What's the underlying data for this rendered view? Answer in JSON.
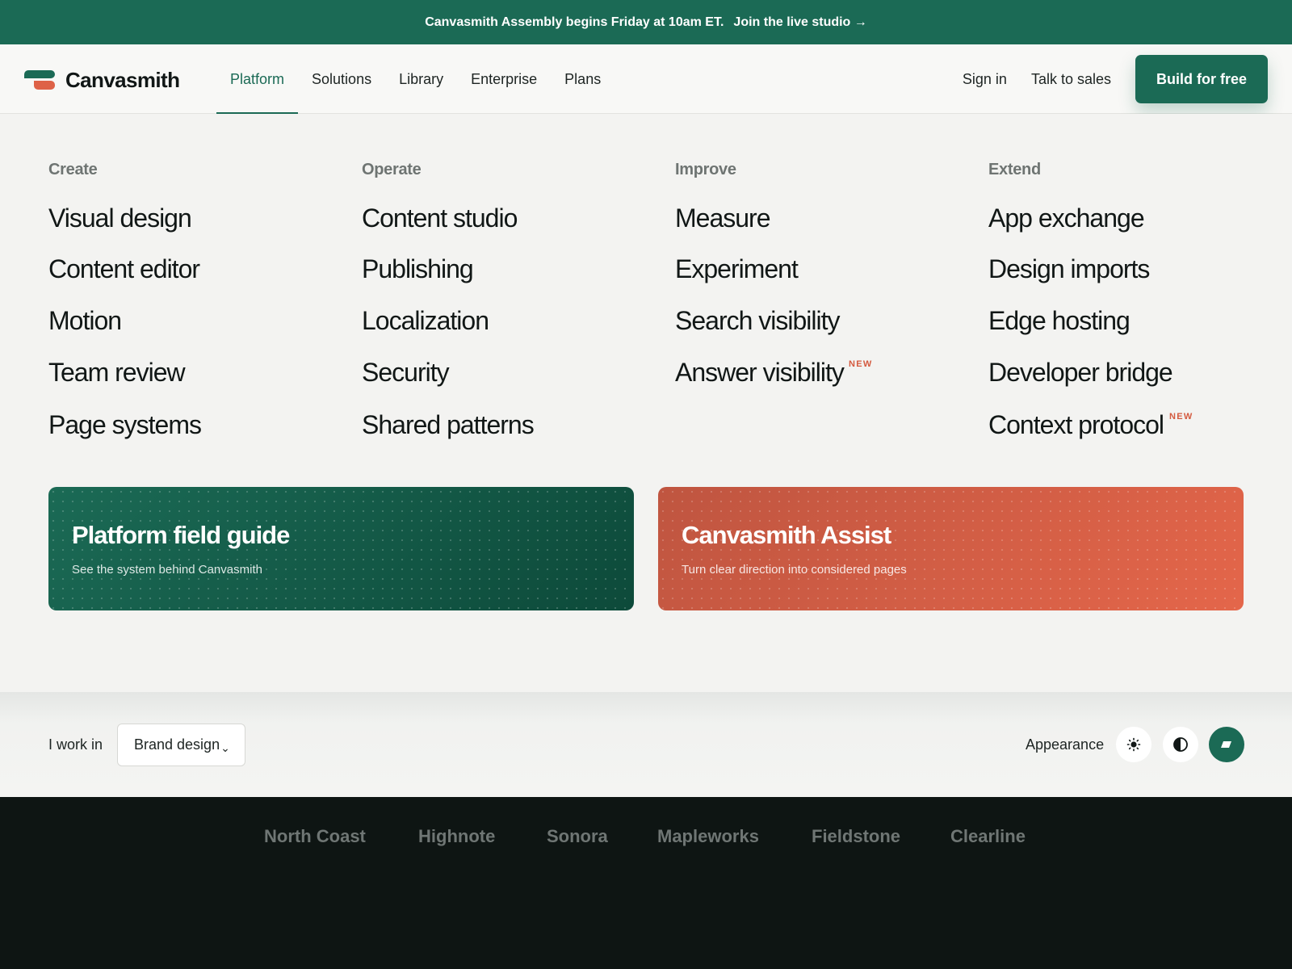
{
  "banner": {
    "text": "Canvasmith Assembly begins Friday at 10am ET.",
    "link": "Join the live studio →"
  },
  "header": {
    "logo_text": "Canvasmith",
    "nav": [
      "Platform",
      "Solutions",
      "Library",
      "Enterprise",
      "Plans"
    ],
    "active_nav": "Platform",
    "sign_in": "Sign in",
    "talk_to_sales": "Talk to sales",
    "cta": "Build for free"
  },
  "menu": {
    "columns": [
      {
        "heading": "Create",
        "items": [
          "Visual design",
          "Content editor",
          "Motion",
          "Team review",
          "Page systems"
        ]
      },
      {
        "heading": "Operate",
        "items": [
          "Content studio",
          "Publishing",
          "Localization",
          "Security",
          "Shared patterns"
        ]
      },
      {
        "heading": "Improve",
        "items": [
          "Measure",
          "Experiment",
          "Search visibility",
          "Answer visibility"
        ]
      },
      {
        "heading": "Extend",
        "items": [
          "App exchange",
          "Design imports",
          "Edge hosting",
          "Developer bridge",
          "Context protocol"
        ]
      }
    ],
    "badge": "NEW"
  },
  "promos": [
    {
      "title": "Platform field guide",
      "subtitle": "See the system behind Canvasmith"
    },
    {
      "title": "Canvasmith Assist",
      "subtitle": "Turn clear direction into considered pages"
    }
  ],
  "preferences": {
    "work_label": "I work in",
    "work_value": "Brand design",
    "chevron": "⌄",
    "appearance_label": "Appearance",
    "theme_icons": [
      "sun-icon",
      "contrast-icon",
      "brand-theme-icon"
    ],
    "active_theme": "brand-theme-icon"
  },
  "footer": {
    "brands": [
      "North Coast",
      "Highnote",
      "Sonora",
      "Mapleworks",
      "Fieldstone",
      "Clearline"
    ]
  },
  "colors": {
    "brand_green": "#1b6a55",
    "accent_orange": "#de6247",
    "badge": "#d45a3f",
    "menu_bg": "#f3f3f1",
    "footer_bg": "#0e1513"
  }
}
